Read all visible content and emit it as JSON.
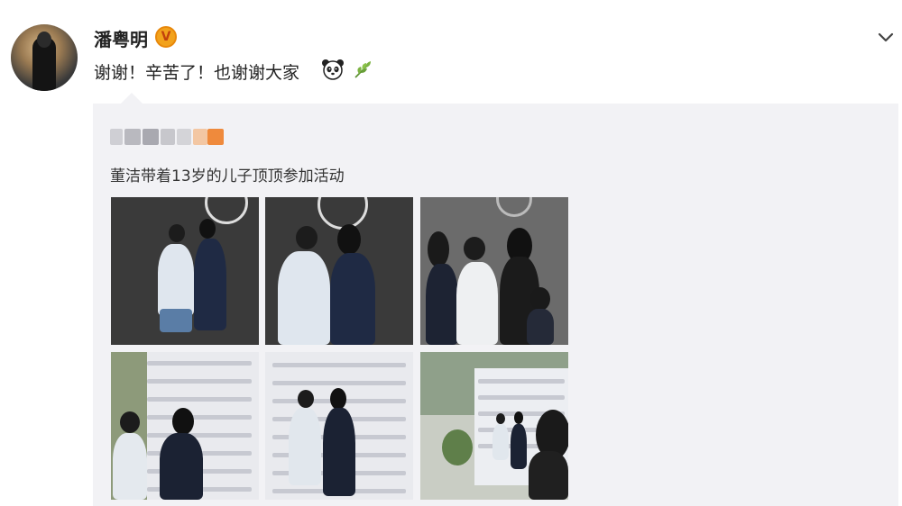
{
  "post": {
    "username": "潘粤明",
    "verified_badge": "V",
    "text": "谢谢！辛苦了！也谢谢大家",
    "emojis": [
      "panda-emoji",
      "leaf-emoji"
    ],
    "menu_icon": "chevron-down-icon"
  },
  "repost": {
    "author_blurred": true,
    "text": "董洁带着13岁的儿子顶顶参加活动",
    "photos": [
      {
        "scene": "dark-backdrop"
      },
      {
        "scene": "dark-backdrop"
      },
      {
        "scene": "group-indoor"
      },
      {
        "scene": "logo-wall"
      },
      {
        "scene": "logo-wall"
      },
      {
        "scene": "outdoor-wall"
      }
    ]
  },
  "colors": {
    "repost_bg": "#f2f2f5",
    "verified": "#f2a21c",
    "text": "#222222"
  }
}
